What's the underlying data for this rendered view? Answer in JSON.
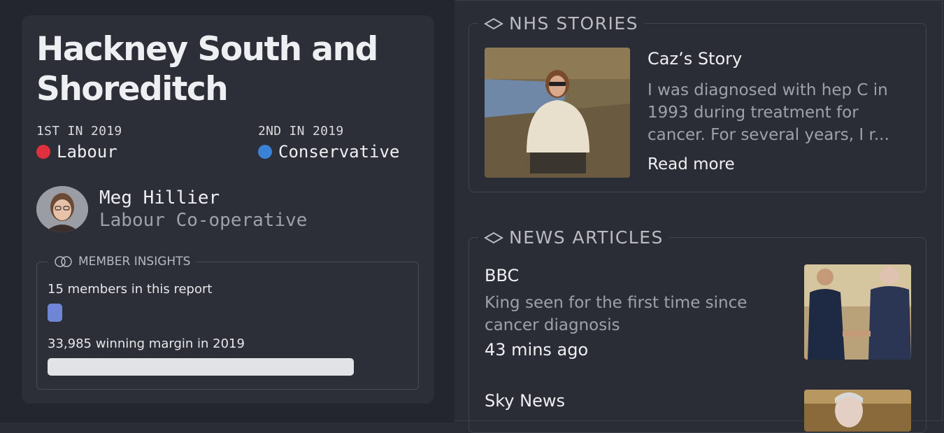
{
  "constituency": {
    "name": "Hackney South and Shoreditch",
    "first": {
      "label": "1ST IN 2019",
      "party": "Labour",
      "color": "#e0303f"
    },
    "second": {
      "label": "2ND IN 2019",
      "party": "Conservative",
      "color": "#3b82d6"
    },
    "mp": {
      "name": "Meg Hillier",
      "party": "Labour Co-operative"
    }
  },
  "insights": {
    "heading": "MEMBER INSIGHTS",
    "members_text": "15 members in this report",
    "members_count": 15,
    "margin_text": "33,985 winning margin in 2019",
    "margin_value": 33985
  },
  "nhs_stories": {
    "heading": "NHS STORIES",
    "items": [
      {
        "title": "Caz’s Story",
        "excerpt": "I was diagnosed with hep C in\n1993 during treatment for\ncancer. For several years, I r...",
        "link": "Read more"
      }
    ]
  },
  "news": {
    "heading": "NEWS ARTICLES",
    "items": [
      {
        "source": "BBC",
        "title": "King seen for the first time since cancer diagnosis",
        "time": "43 mins ago"
      },
      {
        "source": "Sky News"
      }
    ]
  },
  "colors": {
    "members_bar": "#6f86d6",
    "margin_bar": "#e2e3e6"
  }
}
